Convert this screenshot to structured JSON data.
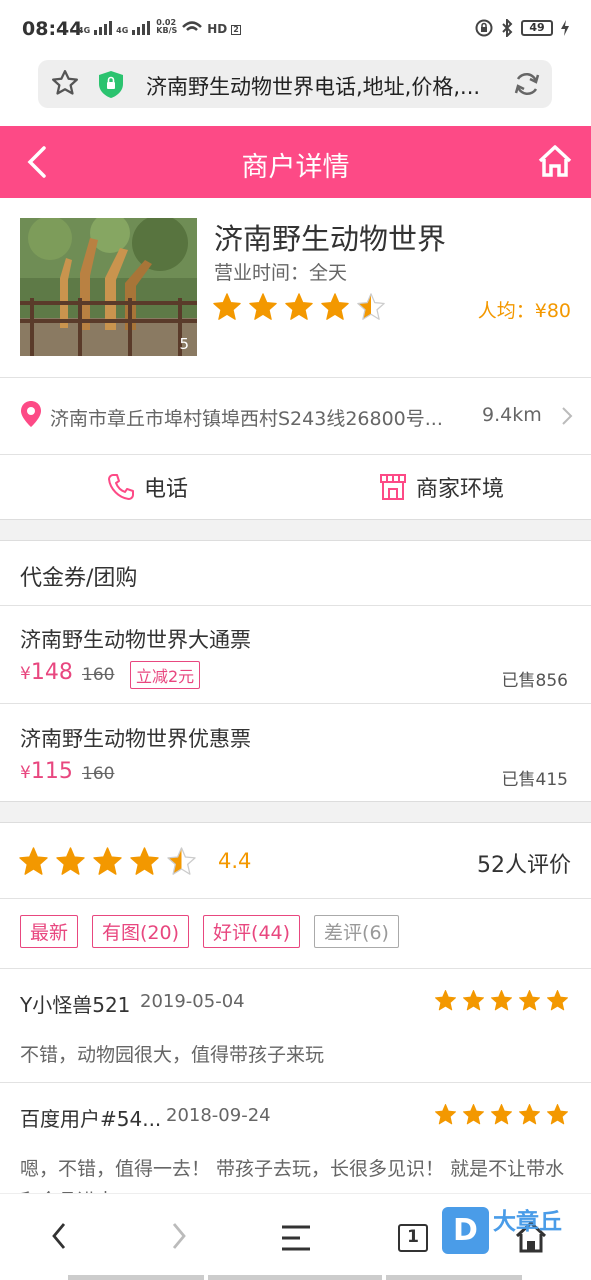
{
  "status": {
    "time": "08:44",
    "net1": "4G",
    "net2": "4G",
    "speed_value": "0.02",
    "speed_unit": "KB/S",
    "hd": "HD",
    "hd_sub": "2",
    "battery": "49"
  },
  "browser": {
    "url": "济南野生动物世界电话,地址,价格,..."
  },
  "header": {
    "title": "商户详情"
  },
  "merchant": {
    "name": "济南野生动物世界",
    "hours_label": "营业时间：全天",
    "rating": 4.5,
    "avg_price": "人均：¥80",
    "photo_count": "5"
  },
  "address": {
    "text": "济南市章丘市埠村镇埠西村S243线26800号...",
    "distance": "9.4km"
  },
  "actions": {
    "phone": "电话",
    "environment": "商家环境"
  },
  "coupons": {
    "title": "代金券/团购",
    "items": [
      {
        "name": "济南野生动物世界大通票",
        "currency": "¥",
        "price": "148",
        "original": "160",
        "tag": "立减2元",
        "sold": "已售856"
      },
      {
        "name": "济南野生动物世界优惠票",
        "currency": "¥",
        "price": "115",
        "original": "160",
        "tag": "",
        "sold": "已售415"
      }
    ]
  },
  "rating": {
    "stars": 4.5,
    "score": "4.4",
    "count": "52人评价"
  },
  "filters": [
    "最新",
    "有图(20)",
    "好评(44)",
    "差评(6)"
  ],
  "reviews": [
    {
      "user": "Y小怪兽521",
      "date": "2019-05-04",
      "stars": 5,
      "content": "不错，动物园很大，值得带孩子来玩"
    },
    {
      "user": "百度用户#54...",
      "date": "2018-09-24",
      "stars": 5,
      "content": "嗯，不错，值得一去！ 带孩子去玩，长很多见识！ 就是不让带水和食品进去"
    }
  ],
  "bottom_nav": {
    "tabs_count": "1"
  },
  "watermark": {
    "badge": "D",
    "text": "大章丘"
  },
  "colors": {
    "brand_pink": "#fd4a86",
    "accent_pink": "#e8477f",
    "star_orange": "#f39800"
  }
}
